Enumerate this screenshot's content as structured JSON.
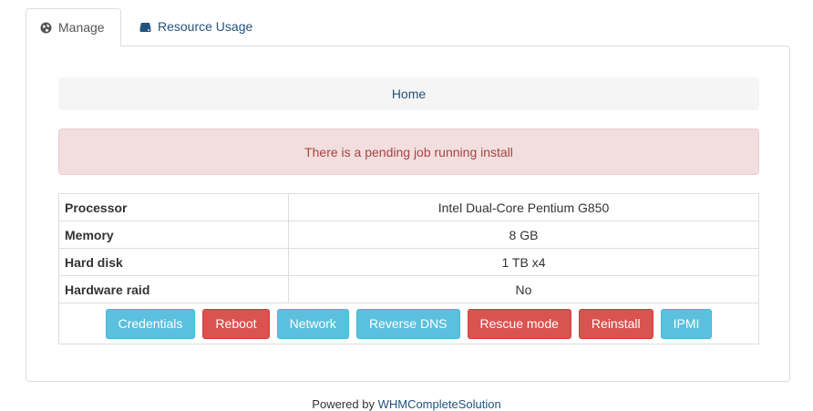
{
  "tabs": {
    "manage": {
      "label": "Manage",
      "icon": "globe-icon"
    },
    "resource_usage": {
      "label": "Resource Usage",
      "icon": "hdd-icon"
    }
  },
  "breadcrumb": {
    "home": "Home"
  },
  "alert": {
    "text": "There is a pending job running install"
  },
  "specs": {
    "processor": {
      "label": "Processor",
      "value": "Intel Dual-Core Pentium G850"
    },
    "memory": {
      "label": "Memory",
      "value": "8 GB"
    },
    "hard_disk": {
      "label": "Hard disk",
      "value": "1 TB x4"
    },
    "hardware_raid": {
      "label": "Hardware raid",
      "value": "No"
    }
  },
  "actions": {
    "credentials": "Credentials",
    "reboot": "Reboot",
    "network": "Network",
    "reverse_dns": "Reverse DNS",
    "rescue_mode": "Rescue mode",
    "reinstall": "Reinstall",
    "ipmi": "IPMI"
  },
  "footer": {
    "prefix": "Powered by",
    "link": "WHMCompleteSolution"
  },
  "colors": {
    "info": "#5bc0de",
    "danger": "#d9534f",
    "alert_bg": "#f2dede",
    "alert_text": "#a94442",
    "link": "#23527c"
  }
}
